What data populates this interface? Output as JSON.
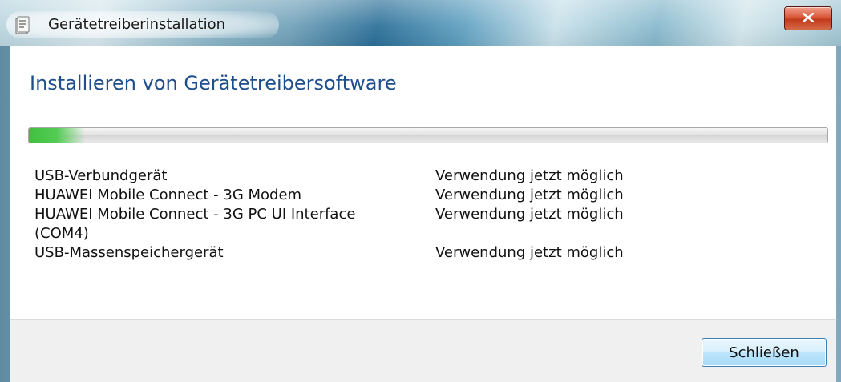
{
  "window": {
    "title": "Gerätetreiberinstallation",
    "close_icon": "close-x-icon",
    "app_icon": "device-driver-icon"
  },
  "main": {
    "heading": "Installieren von Gerätetreibersoftware",
    "progress": 0.07,
    "devices": [
      {
        "name": "USB-Verbundgerät",
        "status": "Verwendung jetzt möglich"
      },
      {
        "name": "HUAWEI Mobile Connect - 3G Modem",
        "status": "Verwendung jetzt möglich"
      },
      {
        "name": "HUAWEI Mobile Connect - 3G PC UI Interface\n(COM4)",
        "status": "Verwendung jetzt möglich"
      },
      {
        "name": "USB-Massenspeichergerät",
        "status": "Verwendung jetzt möglich"
      }
    ]
  },
  "footer": {
    "close_label": "Schließen"
  },
  "colors": {
    "heading": "#1e4f8c",
    "progress_fill": "#3fbf3f",
    "close_button": "#c23a1c"
  }
}
